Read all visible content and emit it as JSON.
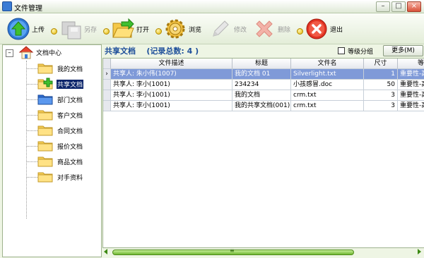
{
  "window": {
    "title": "文件管理"
  },
  "toolbar": {
    "upload": "上传",
    "save_as": "另存",
    "open": "打开",
    "browse": "浏览",
    "edit": "修改",
    "delete": "删除",
    "exit": "退出"
  },
  "tree": {
    "root": "文档中心",
    "items": [
      {
        "label": "我的文档"
      },
      {
        "label": "共享文档"
      },
      {
        "label": "部门文档"
      },
      {
        "label": "客户文档"
      },
      {
        "label": "合同文档"
      },
      {
        "label": "报价文档"
      },
      {
        "label": "商品文档"
      },
      {
        "label": "对手资料"
      }
    ]
  },
  "main": {
    "title": "共享文档",
    "record_count": "(记录总数: 4 )",
    "grade_group": "等级分组",
    "more_button": "更多(M)",
    "columns": [
      "文件描述",
      "标题",
      "文件名",
      "尺寸",
      "等"
    ],
    "rows": [
      {
        "indicator": "›",
        "desc": "共享人: 朱小伟(1007)",
        "title": "我的文档 01",
        "filename": "Silverlight.txt",
        "size": "1",
        "grade": "重要性-高"
      },
      {
        "indicator": "",
        "desc": "共享人: 李小(1001)",
        "title": "234234",
        "filename": "小孩感冒.doc",
        "size": "50",
        "grade": "重要性-高"
      },
      {
        "indicator": "",
        "desc": "共享人: 李小(1001)",
        "title": "我的文档",
        "filename": "crm.txt",
        "size": "3",
        "grade": "重要性-高"
      },
      {
        "indicator": "",
        "desc": "共享人: 李小(1001)",
        "title": "我的共享文档(001)",
        "filename": "crm.txt",
        "size": "3",
        "grade": "重要性-高"
      }
    ],
    "scroll_grip": "≡"
  },
  "colors": {
    "accent": "#1e4f9a",
    "selected_row": "#7f9ad8",
    "tree_selected": "#0a246a"
  }
}
